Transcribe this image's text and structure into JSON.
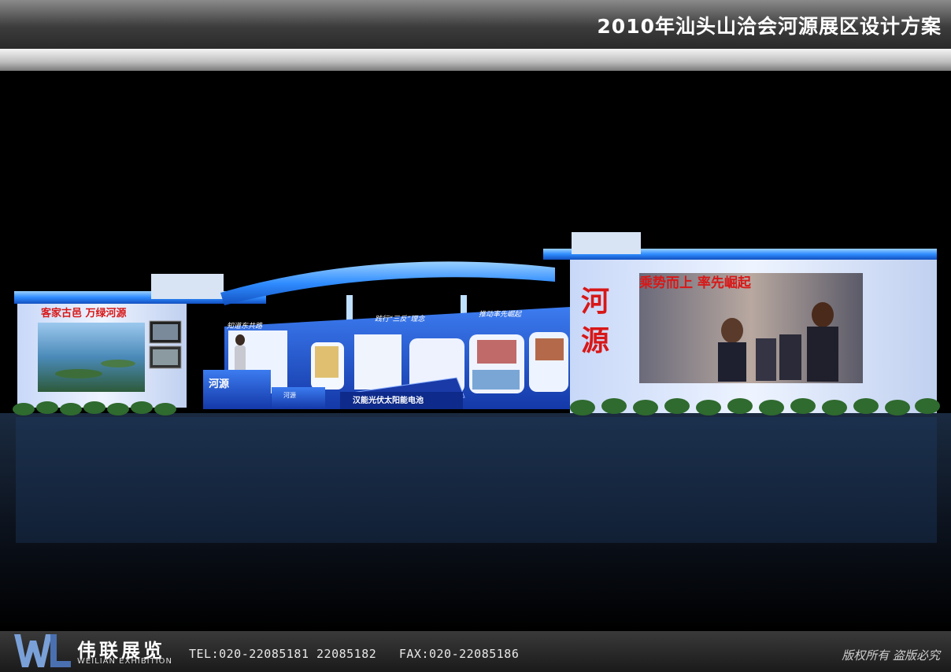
{
  "header": {
    "title": "2010年汕头山洽会河源展区设计方案"
  },
  "booth": {
    "left_banner": "客家古邑   万绿河源",
    "center_banner_1": "知道东共路",
    "center_banner_2": "践行“三反”理念",
    "center_banner_3": "推动率先崛起",
    "right_banner": "乘势而上   率先崛起",
    "right_big_char_1": "河",
    "right_big_char_2": "源",
    "counter_text": "河源",
    "small_counter_text": "河源",
    "solar_panel_caption": "汉能光伏太阳能电池"
  },
  "footer": {
    "brand_cn": "伟联展览",
    "brand_en": "WEILIAN EXHIBITION",
    "contact": "TEL:020-22085181 22085182   FAX:020-22085186",
    "copyright": "版权所有  盗版必究"
  },
  "colors": {
    "header_text": "#ffffff",
    "booth_blue": "#1a5fd6",
    "glow_blue": "#3aa0ff",
    "banner_red": "#d81818",
    "panel_white": "#e8f0ff"
  }
}
